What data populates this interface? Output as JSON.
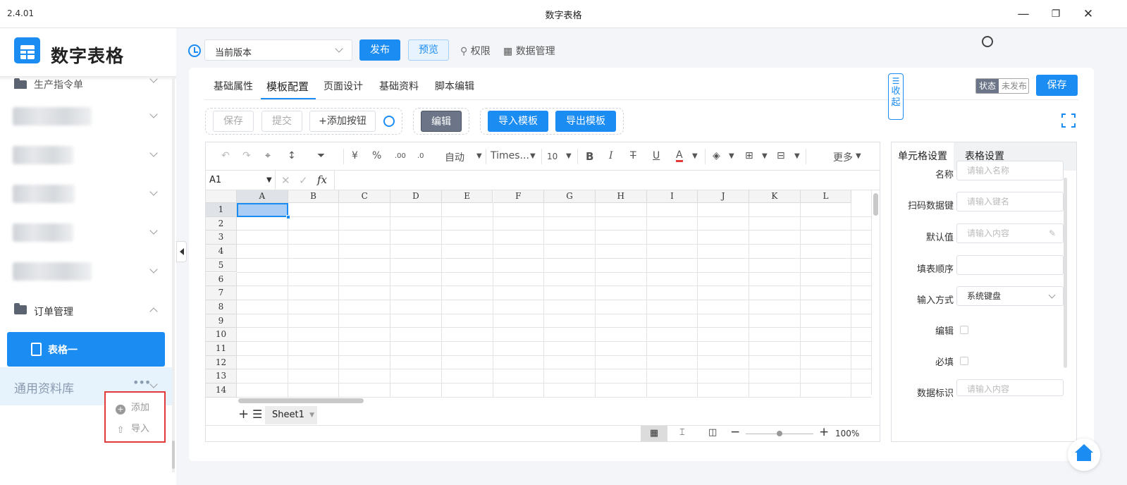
{
  "window": {
    "version": "2.4.01",
    "title": "数字表格",
    "minimize": "—",
    "restore": "❐",
    "close": "✕"
  },
  "sidebar": {
    "app_title": "数字表格",
    "partial_item": "生产指令单",
    "order_folder": "订单管理",
    "active_item": "表格一",
    "common_lib": "通用资料库",
    "common_dots": "•••",
    "popup": {
      "add": "添加",
      "import": "导入"
    }
  },
  "toolbar": {
    "version_select": "当前版本",
    "publish": "发布",
    "preview": "预览",
    "permission": "权限",
    "data_manage": "数据管理"
  },
  "tabs": [
    "基础属性",
    "模板配置",
    "页面设计",
    "基础资料",
    "脚本编辑"
  ],
  "status": {
    "label": "状态",
    "value": "未发布"
  },
  "save_main": "保存",
  "action_bar": {
    "save": "保存",
    "submit": "提交",
    "add_button": "+添加按钮",
    "edit": "编辑",
    "import_template": "导入模板",
    "export_template": "导出模板"
  },
  "ribbon": {
    "undo": "↶",
    "redo": "↷",
    "brush": "⌖",
    "sort": "↕",
    "filter": "⏷",
    "yuan": "¥",
    "percent": "%",
    "dec_inc": ".00",
    "dec_dec": ".0",
    "auto": "自动",
    "font": "Times...",
    "size": "10",
    "bold": "B",
    "italic": "I",
    "strike": "T",
    "underline": "U",
    "color": "A",
    "more": "更多"
  },
  "formula": {
    "cell_ref": "A1",
    "fx": "fx"
  },
  "columns": [
    "A",
    "B",
    "C",
    "D",
    "E",
    "F",
    "G",
    "H",
    "I",
    "J",
    "K",
    "L"
  ],
  "rows": [
    "1",
    "2",
    "3",
    "4",
    "5",
    "6",
    "7",
    "8",
    "9",
    "10",
    "11",
    "12",
    "13",
    "14"
  ],
  "sheet_tab": "Sheet1",
  "zoom": "100%",
  "props": {
    "tab_cell": "单元格设置",
    "tab_table": "表格设置",
    "fields": [
      {
        "label": "名称",
        "placeholder": "请输入名称"
      },
      {
        "label": "扫码数据键",
        "placeholder": "请输入键名"
      },
      {
        "label": "默认值",
        "placeholder": "请输入内容"
      },
      {
        "label": "填表顺序",
        "placeholder": ""
      },
      {
        "label": "输入方式",
        "value": "系统键盘"
      },
      {
        "label": "编辑"
      },
      {
        "label": "必填"
      },
      {
        "label": "数据标识",
        "placeholder": "请输入内容"
      }
    ]
  },
  "collapse_label": "收起",
  "colors": {
    "accent": "#1a8cf2",
    "danger": "#e23a3a"
  }
}
